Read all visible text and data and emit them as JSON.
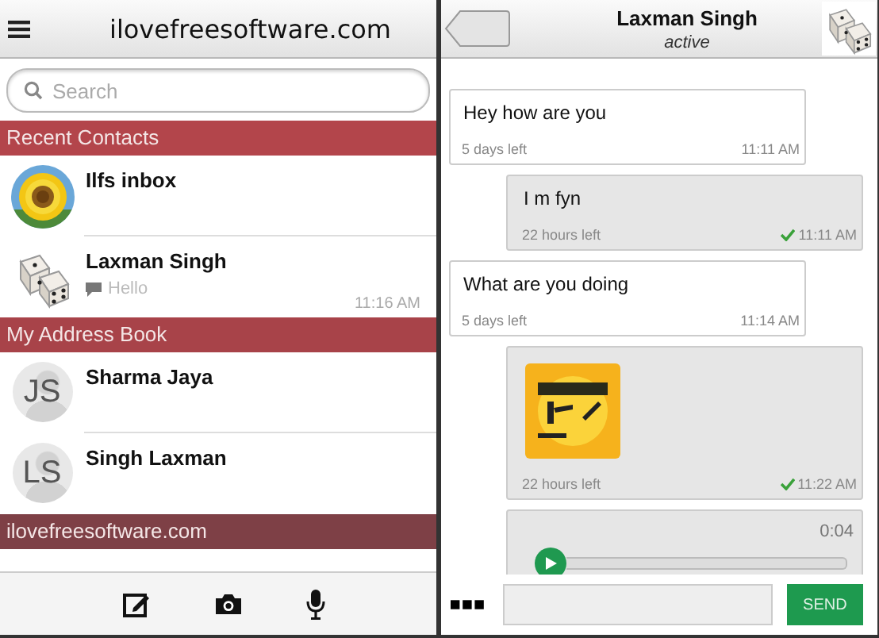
{
  "contacts_screen": {
    "title": "ilovefreesoftware.com",
    "search": {
      "placeholder": "Search"
    },
    "sections": [
      {
        "title": "Recent Contacts",
        "color": "#b3454b",
        "contacts": [
          {
            "name": "Ilfs inbox"
          },
          {
            "name": "Laxman Singh",
            "avatar": {
              "kind": "dice"
            },
            "preview": "Hello",
            "time": "11:16 AM"
          }
        ]
      },
      {
        "title": "My Address Book",
        "color": "#a84349",
        "contacts": [
          {
            "name": "Sharma Jaya",
            "avatar": {
              "kind": "initials",
              "initials": "JS"
            }
          },
          {
            "name": "Singh Laxman",
            "avatar": {
              "kind": "initials",
              "initials": "LS"
            }
          }
        ]
      },
      {
        "title": "ilovefreesoftware.com",
        "color": "#7e4046"
      }
    ]
  },
  "chat_screen": {
    "contact": {
      "name": "Laxman Singh",
      "status": "active"
    },
    "messages": [
      {
        "kind": "text",
        "outgoing": false,
        "text": "Hey how are you",
        "expiry": "5 days left",
        "time": "11:11 AM",
        "delivered": false
      },
      {
        "kind": "text",
        "outgoing": true,
        "text": "I m fyn",
        "expiry": "22 hours left",
        "time": "11:11 AM",
        "delivered": true
      },
      {
        "kind": "text",
        "outgoing": false,
        "text": "What are you doing",
        "expiry": "5 days left",
        "time": "11:14 AM",
        "delivered": false
      },
      {
        "outgoing": true,
        "expiry": "22 hours left",
        "time": "11:22 AM",
        "delivered": true
      },
      {
        "kind": "audio",
        "outgoing": true,
        "duration": "0:04"
      }
    ],
    "send_button": "SEND"
  }
}
